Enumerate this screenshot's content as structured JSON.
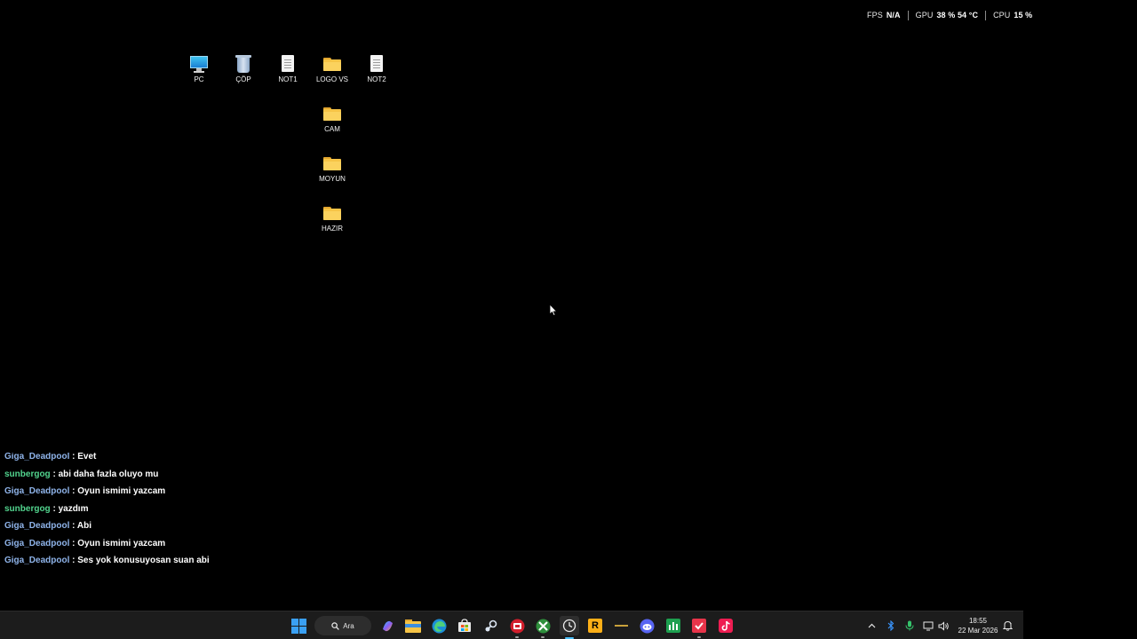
{
  "overlay_stats": {
    "fps_label": "FPS",
    "fps_value": "N/A",
    "gpu_label": "GPU",
    "gpu_value": "38 % 54 °C",
    "cpu_label": "CPU",
    "cpu_value": "15 %"
  },
  "desktop_icons": [
    {
      "label": "PC",
      "icon": "pc-monitor-icon"
    },
    {
      "label": "ÇÖP",
      "icon": "recycle-bin-icon"
    },
    {
      "label": "NOT1",
      "icon": "text-file-icon"
    },
    {
      "label": "LOGO VS",
      "icon": "folder-icon"
    },
    {
      "label": "NOT2",
      "icon": "text-file-icon"
    },
    {
      "label": "CAM",
      "icon": "folder-icon"
    },
    {
      "label": "MOYUN",
      "icon": "folder-icon"
    },
    {
      "label": "HAZIR",
      "icon": "folder-icon"
    }
  ],
  "chat": {
    "separator": ":",
    "messages": [
      {
        "user": "Giga_Deadpool",
        "text": "Evet",
        "color": "#8fb4ea"
      },
      {
        "user": "sunbergog",
        "text": "abi daha fazla oluyo mu",
        "color": "#52d48e"
      },
      {
        "user": "Giga_Deadpool",
        "text": "Oyun ismimi yazcam",
        "color": "#8fb4ea"
      },
      {
        "user": "sunbergog",
        "text": "yazdım",
        "color": "#52d48e"
      },
      {
        "user": "Giga_Deadpool",
        "text": "Abi",
        "color": "#8fb4ea"
      },
      {
        "user": "Giga_Deadpool",
        "text": "Oyun ismimi yazcam",
        "color": "#8fb4ea"
      },
      {
        "user": "Giga_Deadpool",
        "text": "Ses yok konusuyosan suan abi",
        "color": "#8fb4ea"
      }
    ]
  },
  "taskbar": {
    "search_label": "Ara",
    "apps": [
      {
        "name": "copilot-icon"
      },
      {
        "name": "file-explorer-icon"
      },
      {
        "name": "edge-browser-icon"
      },
      {
        "name": "microsoft-store-icon"
      },
      {
        "name": "steam-icon"
      },
      {
        "name": "red-game-app-icon"
      },
      {
        "name": "xbox-icon"
      },
      {
        "name": "clock-app-icon"
      },
      {
        "name": "rockstar-launcher-icon",
        "glyph": "R"
      },
      {
        "name": "dash-app-icon"
      },
      {
        "name": "discord-icon"
      },
      {
        "name": "green-chart-app-icon"
      },
      {
        "name": "red-check-app-icon"
      },
      {
        "name": "tiktok-icon"
      }
    ],
    "clock": {
      "time": "18:55",
      "date": "22 Mar 2026"
    }
  }
}
